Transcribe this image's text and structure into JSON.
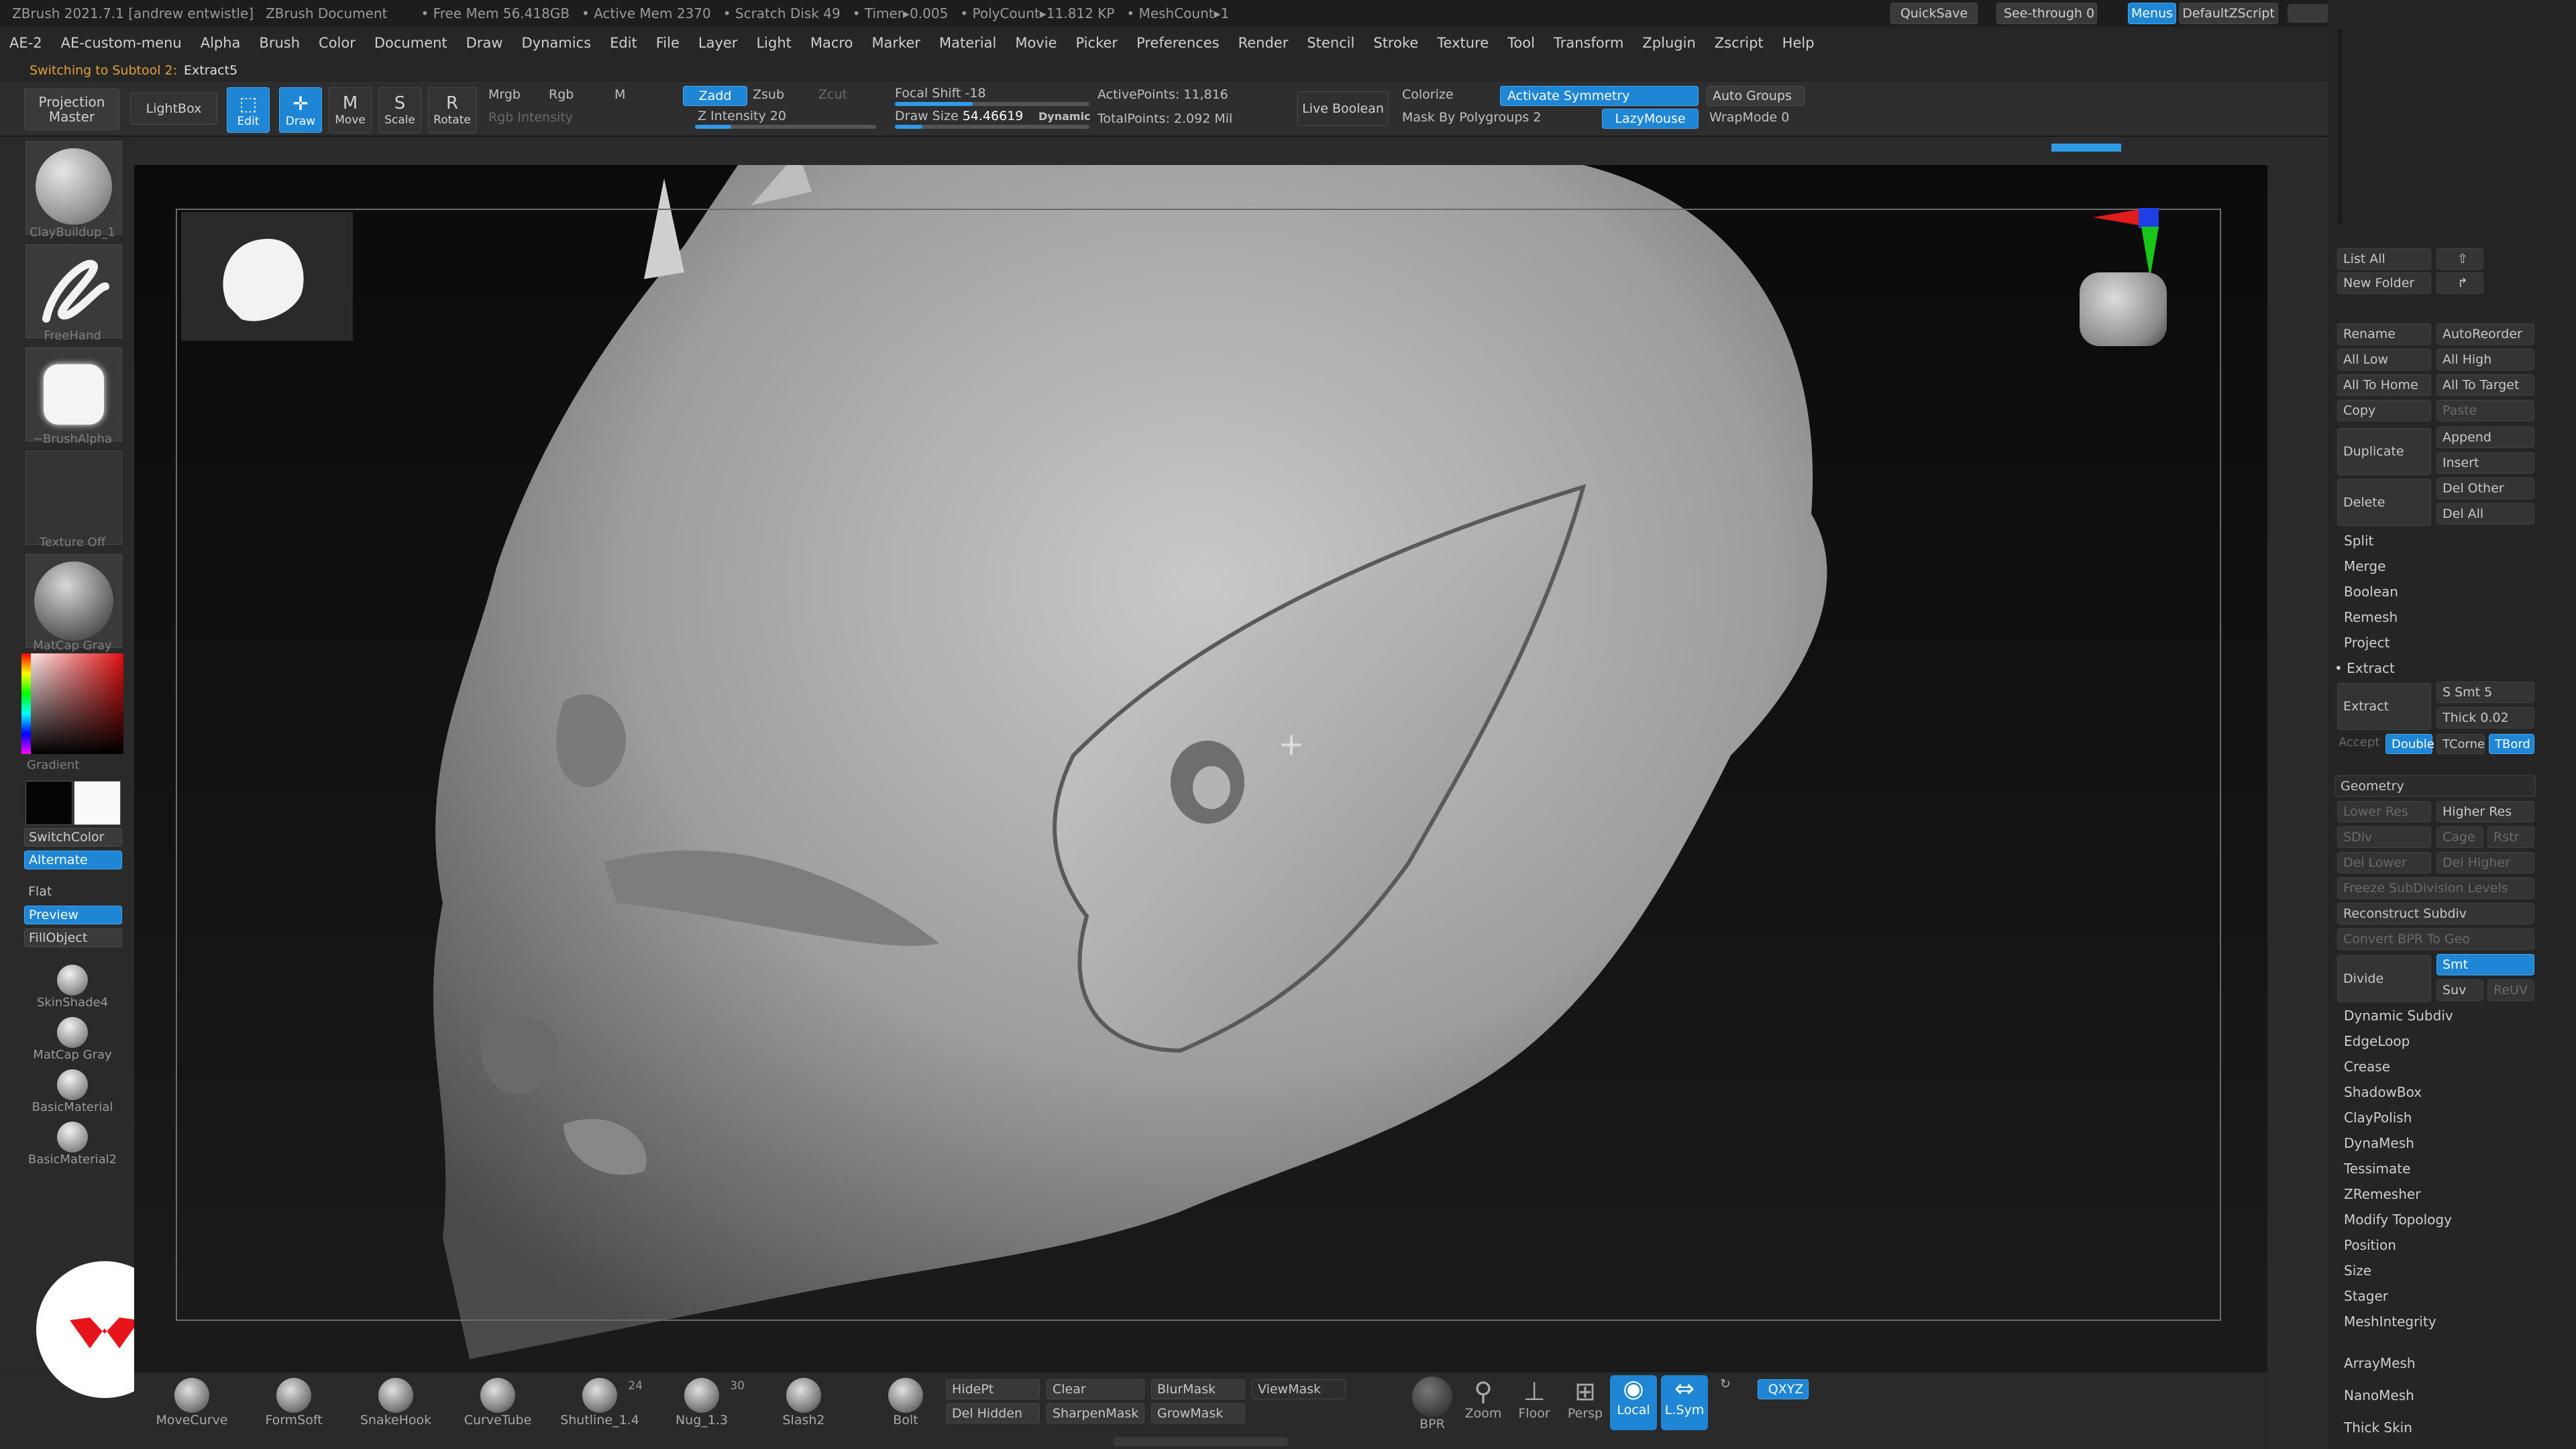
{
  "titlebar": {
    "app": "ZBrush 2021.7.1 [andrew entwistle]",
    "doc": "ZBrush Document",
    "free_mem": "• Free Mem 56.418GB",
    "active_mem": "• Active Mem 2370",
    "scratch": "• Scratch Disk 49",
    "timer": "• Timer▸0.005",
    "polycount": "• PolyCount▸11.812 KP",
    "meshcount": "• MeshCount▸1",
    "quicksave": "QuickSave",
    "seethrough": "See-through  0",
    "menus": "Menus",
    "script": "DefaultZScript"
  },
  "menubar": [
    "AE-2",
    "AE-custom-menu",
    "Alpha",
    "Brush",
    "Color",
    "Document",
    "Draw",
    "Dynamics",
    "Edit",
    "File",
    "Layer",
    "Light",
    "Macro",
    "Marker",
    "Material",
    "Movie",
    "Picker",
    "Preferences",
    "Render",
    "Stencil",
    "Stroke",
    "Texture",
    "Tool",
    "Transform",
    "Zplugin",
    "Zscript",
    "Help"
  ],
  "note": {
    "prefix": "Switching to Subtool 2:",
    "value": "Extract5"
  },
  "toolbar": {
    "projection": "Projection Master",
    "lightbox": "LightBox",
    "edit": "Edit",
    "draw": "Draw",
    "move": "Move",
    "scale": "Scale",
    "rotate": "Rotate",
    "mrgb": "Mrgb",
    "rgb": "Rgb",
    "m": "M",
    "rgb_intensity": "Rgb Intensity",
    "zadd": "Zadd",
    "zsub": "Zsub",
    "zcut": "Zcut",
    "z_intensity": "Z Intensity 20",
    "z_intensity_value": 0.2,
    "focal_shift": "Focal Shift -18",
    "draw_size_label": "Draw Size",
    "draw_size_value": "54.46619",
    "dynamic": "Dynamic",
    "active_points": "ActivePoints: 11,816",
    "total_points": "TotalPoints: 2.092 Mil",
    "live_boolean": "Live Boolean",
    "colorize": "Colorize",
    "activate_symmetry": "Activate Symmetry",
    "mask_polygroups": "Mask By Polygroups 2",
    "lazymouse": "LazyMouse",
    "auto_groups": "Auto Groups",
    "wrapmode": "WrapMode 0"
  },
  "leftshelf": {
    "brush1": "ClayBuildup_1",
    "stroke": "FreeHand",
    "alpha": "~BrushAlpha",
    "texture": "Texture Off",
    "matcap": "MatCap Gray",
    "gradient": "Gradient",
    "switchcolor": "SwitchColor",
    "alternate": "Alternate",
    "flat": "Flat",
    "preview": "Preview",
    "fillobject": "FillObject",
    "materials": [
      "SkinShade4",
      "MatCap Gray",
      "BasicMaterial",
      "BasicMaterial2"
    ]
  },
  "rightpanel": {
    "list_all": "List All",
    "new_folder": "New Folder",
    "rename": "Rename",
    "autoreorder": "AutoReorder",
    "all_low": "All Low",
    "all_high": "All High",
    "all_to_home": "All To Home",
    "all_to_target": "All To Target",
    "copy": "Copy",
    "paste": "Paste",
    "duplicate": "Duplicate",
    "append": "Append",
    "insert": "Insert",
    "delete": "Delete",
    "del_other": "Del Other",
    "del_all": "Del All",
    "split": "Split",
    "merge": "Merge",
    "boolean": "Boolean",
    "remesh": "Remesh",
    "project": "Project",
    "extract_section": "• Extract",
    "extract": "Extract",
    "s_smt": "S Smt 5",
    "thick": "Thick 0.02",
    "accept": "Accept",
    "double": "Double",
    "tcorne": "TCorne",
    "tbord": "TBord",
    "geometry": "Geometry",
    "lower_res": "Lower Res",
    "higher_res": "Higher Res",
    "sdiv": "SDiv",
    "cage": "Cage",
    "rstr": "Rstr",
    "del_lower": "Del Lower",
    "del_higher": "Del Higher",
    "freeze": "Freeze SubDivision Levels",
    "reconstruct": "Reconstruct Subdiv",
    "convert_bpr": "Convert BPR To Geo",
    "divide": "Divide",
    "smt": "Smt",
    "suv": "Suv",
    "reuv": "ReUV",
    "geo_list": [
      "Dynamic Subdiv",
      "EdgeLoop",
      "Crease",
      "ShadowBox",
      "ClayPolish",
      "DynaMesh",
      "Tessimate",
      "ZRemesher",
      "Modify Topology",
      "Position",
      "Size",
      "Stager",
      "MeshIntegrity"
    ],
    "plugins": [
      "ArrayMesh",
      "NanoMesh",
      "Thick Skin"
    ]
  },
  "bottomshelf": {
    "brushes": [
      {
        "name": "MoveCurve",
        "num": ""
      },
      {
        "name": "FormSoft",
        "num": ""
      },
      {
        "name": "SnakeHook",
        "num": ""
      },
      {
        "name": "CurveTube",
        "num": ""
      },
      {
        "name": "Shutline_1.4",
        "num": "24"
      },
      {
        "name": "Nug_1.3",
        "num": "30"
      },
      {
        "name": "Slash2",
        "num": ""
      },
      {
        "name": "Bolt",
        "num": ""
      }
    ],
    "hidept": "HidePt",
    "del_hidden": "Del Hidden",
    "clear": "Clear",
    "sharpenmask": "SharpenMask",
    "blurmask": "BlurMask",
    "growmask": "GrowMask",
    "viewmask": "ViewMask",
    "bpr": "BPR",
    "zoom": "Zoom",
    "floor": "Floor",
    "persp": "Persp",
    "local": "Local",
    "lsym": "L.Sym",
    "xyz": "QXYZ"
  },
  "colors": {
    "accent": "#1f86d6",
    "bg": "#2b2b2b",
    "viewport": "#0e0e0e"
  }
}
